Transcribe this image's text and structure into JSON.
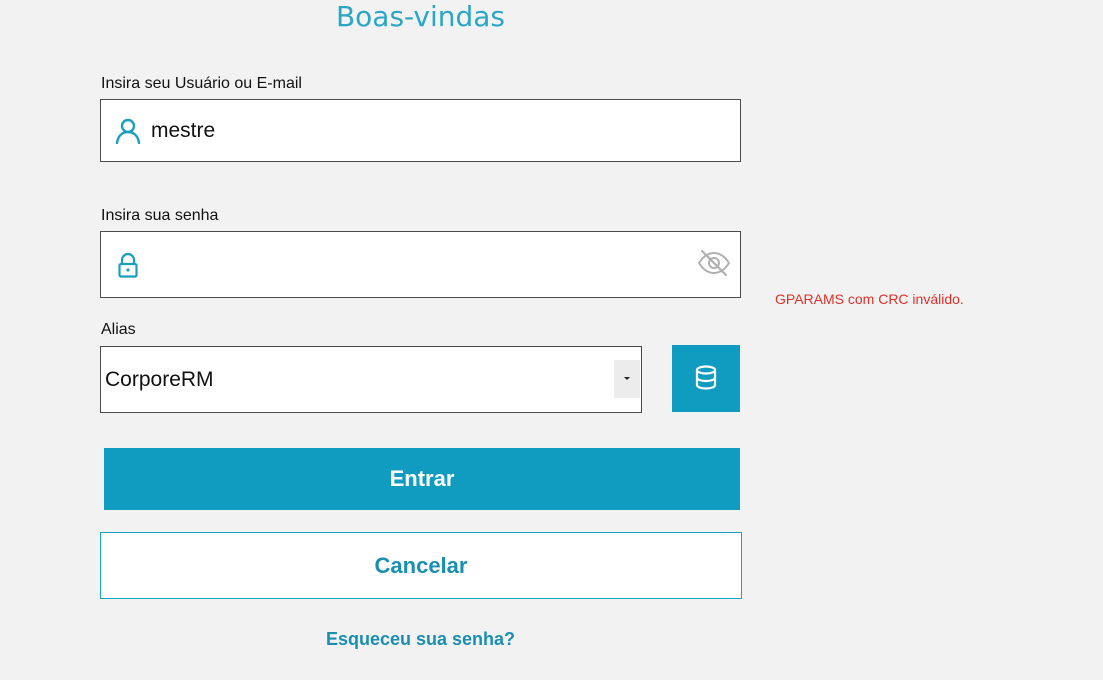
{
  "header": {
    "title": "Boas-vindas"
  },
  "user_field": {
    "label": "Insira seu Usuário ou E-mail",
    "value": "mestre",
    "icon": "user-icon"
  },
  "password_field": {
    "label": "Insira sua senha",
    "value": "",
    "icon": "lock-icon",
    "toggle_icon": "eye-off-icon"
  },
  "error": {
    "message": "GPARAMS com CRC inválido."
  },
  "alias": {
    "label": "Alias",
    "selected": "CorporeRM",
    "db_icon": "database-icon"
  },
  "actions": {
    "login_label": "Entrar",
    "cancel_label": "Cancelar",
    "forgot_label": "Esqueceu sua senha?"
  },
  "colors": {
    "accent": "#0f9cc0",
    "title": "#2ba7c6",
    "error": "#e0302a",
    "background": "#f2f2f2"
  }
}
